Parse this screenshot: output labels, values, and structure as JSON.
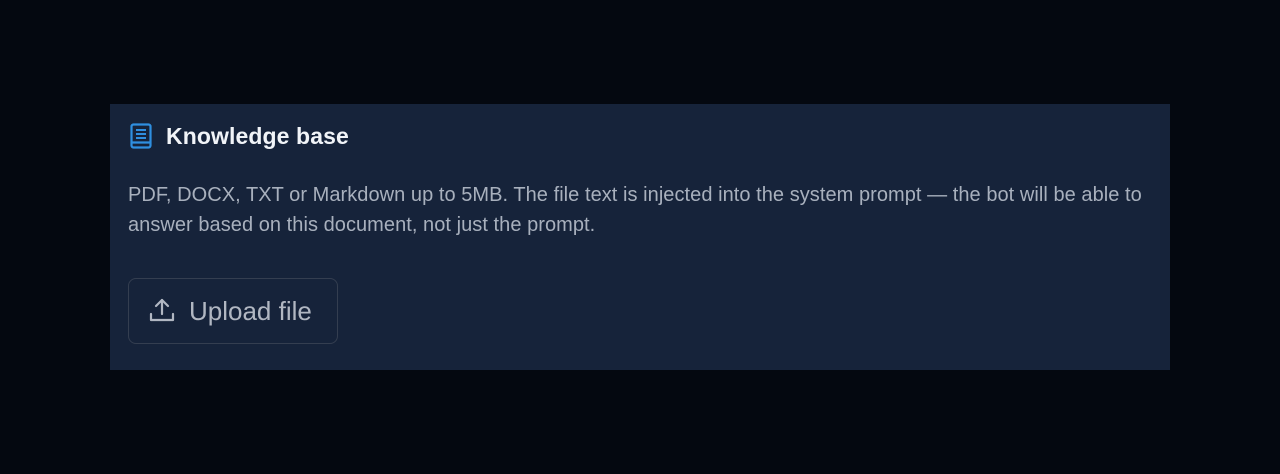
{
  "knowledge_base": {
    "title": "Knowledge base",
    "icon": "book-icon",
    "description": "PDF, DOCX, TXT or Markdown up to 5MB. The file text is injected into the system prompt — the bot will be able to answer based on this document, not just the prompt.",
    "upload_button": {
      "label": "Upload file",
      "icon": "upload-icon"
    }
  },
  "colors": {
    "page_background": "#040810",
    "card_background": "#16233a",
    "accent_icon": "#2f8fe0",
    "title_text": "#f1f4f8",
    "body_text": "#a8b0bd",
    "button_border": "#343e50"
  }
}
